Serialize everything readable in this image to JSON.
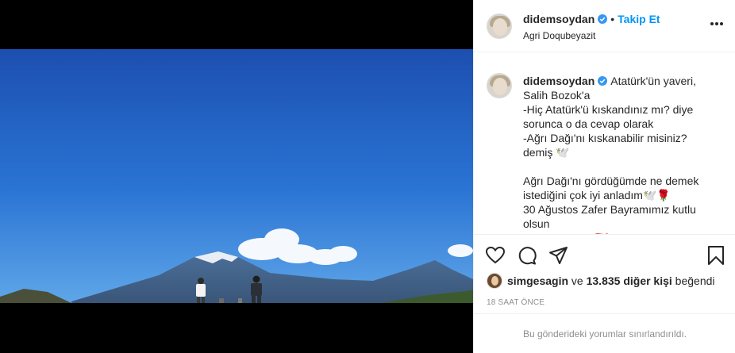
{
  "post": {
    "username": "didemsoydan",
    "follow_label": "Takip Et",
    "separator": "•",
    "location": "Agri Doqubeyazit",
    "caption_text": "Atatürk'ün yaveri,\nSalih Bozok'a\n-Hiç Atatürk'ü kıskandınız mı? diye sorunca o da cevap olarak\n-Ağrı Dağı'nı kıskanabilir misiniz? demiş 🕊️\n\nAğrı Dağı'nı gördüğümde ne demek istediğini çok iyi anladım🕊️🌹\n30 Ağustos Zafer Bayramımız kutlu olsun\nNe mutlu bize 🇹🇷"
  },
  "likes": {
    "liker": "simgesagin",
    "connector": " ve ",
    "others": "13.835 diğer kişi",
    "suffix": " beğendi"
  },
  "timestamp": "18 SAAT ÖNCE",
  "comments_notice": "Bu gönderideki yorumlar sınırlandırıldı.",
  "icons": {
    "like": "heart-icon",
    "comment": "comment-icon",
    "share": "share-icon",
    "save": "bookmark-icon",
    "verified": "verified-badge-icon",
    "more": "more-options-icon"
  },
  "colors": {
    "accent": "#0095f6",
    "text": "#262626",
    "muted": "#8e8e8e",
    "border": "#efefef"
  }
}
